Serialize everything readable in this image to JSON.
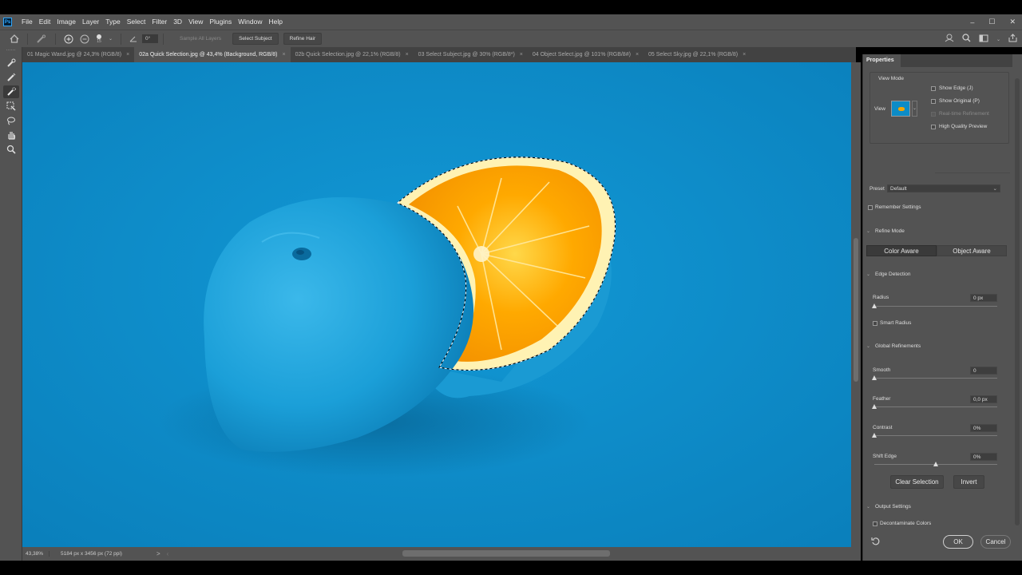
{
  "menubar": {
    "logo": "Ps",
    "items": [
      "File",
      "Edit",
      "Image",
      "Layer",
      "Type",
      "Select",
      "Filter",
      "3D",
      "View",
      "Plugins",
      "Window",
      "Help"
    ],
    "window_controls": [
      "–",
      "☐",
      "✕"
    ]
  },
  "options": {
    "brush_size": "15",
    "angle": "0°",
    "sample_all_layers": "Sample All Layers",
    "select_subject": "Select Subject",
    "refine_hair": "Refine Hair"
  },
  "tabs": [
    {
      "label": "01 Magic Wand.jpg @ 24,3% (RGB/8)",
      "close": "×",
      "active": false
    },
    {
      "label": "02a Quick Selection.jpg @ 43,4% (Background, RGB/8)",
      "close": "×",
      "active": true
    },
    {
      "label": "02b Quick Selection.jpg @ 22,1% (RGB/8)",
      "close": "×",
      "active": false
    },
    {
      "label": "03 Select Subject.jpg @ 30% (RGB/8*)",
      "close": "×",
      "active": false
    },
    {
      "label": "04 Object Select.jpg @ 101% (RGB/8#)",
      "close": "×",
      "active": false
    },
    {
      "label": "05 Select Sky.jpg @ 22,1% (RGB/8)",
      "close": "×",
      "active": false
    }
  ],
  "status": {
    "zoom": "43,38%",
    "doc_info": "5184 px x 3456 px (72 ppi)",
    "arrow": ">"
  },
  "properties": {
    "panel_title": "Properties",
    "view_mode": {
      "title": "View Mode",
      "view_label": "View",
      "show_edge": "Show Edge (J)",
      "show_original": "Show Original (P)",
      "realtime": "Real-time Refinement",
      "high_quality": "High Quality Preview"
    },
    "preset_label": "Preset",
    "preset_value": "Default",
    "remember_settings": "Remember Settings",
    "refine_mode": {
      "title": "Refine Mode",
      "color_aware": "Color Aware",
      "object_aware": "Object Aware"
    },
    "edge_detection": {
      "title": "Edge Detection",
      "radius_label": "Radius",
      "radius_value": "0 px",
      "smart_radius": "Smart Radius"
    },
    "global_refinements": {
      "title": "Global Refinements",
      "smooth_label": "Smooth",
      "smooth_value": "0",
      "feather_label": "Feather",
      "feather_value": "0,0 px",
      "contrast_label": "Contrast",
      "contrast_value": "0%",
      "shift_edge_label": "Shift Edge",
      "shift_edge_value": "0%"
    },
    "clear_selection": "Clear Selection",
    "invert": "Invert",
    "output_settings": {
      "title": "Output Settings",
      "decontaminate": "Decontaminate Colors"
    },
    "ok": "OK",
    "cancel": "Cancel"
  },
  "colors": {
    "canvas_bg": "#0d8cc7",
    "orange_flesh": "#f7a800",
    "ui_panel": "#535353"
  },
  "sliders": {
    "radius": 0,
    "smooth": 0,
    "feather": 0,
    "contrast": 0,
    "shift_edge": 0
  }
}
